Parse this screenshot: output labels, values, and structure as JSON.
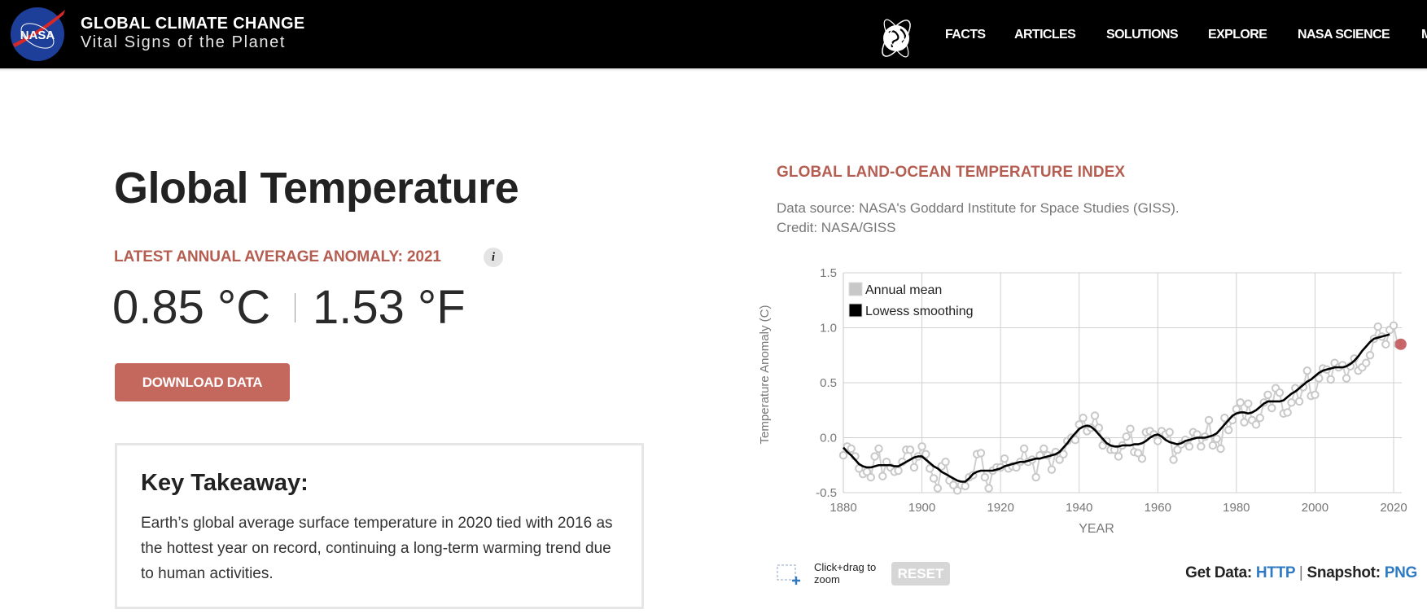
{
  "header": {
    "site_title": "GLOBAL CLIMATE CHANGE",
    "site_subtitle": "Vital Signs of the Planet",
    "logo_text": "NASA",
    "nav": [
      "FACTS",
      "ARTICLES",
      "SOLUTIONS",
      "EXPLORE",
      "NASA SCIENCE",
      "M"
    ]
  },
  "main": {
    "title": "Global Temperature",
    "anomaly_label": "LATEST ANNUAL AVERAGE ANOMALY: 2021",
    "info_icon": "i",
    "value_celsius": "0.85 °C",
    "value_fahrenheit": "1.53 °F",
    "download_label": "DOWNLOAD DATA",
    "takeaway_title": "Key Takeaway:",
    "takeaway_text": "Earth’s global average surface temperature in 2020 tied with 2016 as the hottest year on record, continuing a long-term warming trend due to human activities."
  },
  "chart_panel": {
    "title": "GLOBAL LAND-OCEAN TEMPERATURE INDEX",
    "source_line1": "Data source: NASA's Goddard Institute for Space Studies (GISS).",
    "source_line2": "Credit: NASA/GISS",
    "zoom_hint": "Click+drag to zoom",
    "reset_label": "RESET",
    "get_data_label": "Get Data:",
    "get_data_link": "HTTP",
    "separator": "|",
    "snapshot_label": "Snapshot:",
    "snapshot_link": "PNG"
  },
  "colors": {
    "accent": "#b55d51",
    "button": "#c4675d",
    "link": "#2e7bc4",
    "annual_mean": "#c8c8c8",
    "lowess": "#000000",
    "highlight": "#c4575a"
  },
  "chart_data": {
    "type": "line",
    "title": "GLOBAL LAND-OCEAN TEMPERATURE INDEX",
    "xlabel": "YEAR",
    "ylabel": "Temperature Anomaly (C)",
    "xlim": [
      1880,
      2021
    ],
    "ylim": [
      -0.5,
      1.5
    ],
    "xticks": [
      1880,
      1900,
      1920,
      1940,
      1960,
      1980,
      2000,
      2020
    ],
    "yticks": [
      "-0.5",
      "0.0",
      "0.5",
      "1.0",
      "1.5"
    ],
    "grid": true,
    "legend_position": "top-left",
    "legend": [
      "Annual mean",
      "Lowess smoothing"
    ],
    "x_start": 1880,
    "series": [
      {
        "name": "Annual mean",
        "values": [
          -0.16,
          -0.08,
          -0.1,
          -0.17,
          -0.28,
          -0.33,
          -0.31,
          -0.36,
          -0.17,
          -0.1,
          -0.35,
          -0.22,
          -0.27,
          -0.31,
          -0.3,
          -0.22,
          -0.11,
          -0.11,
          -0.27,
          -0.17,
          -0.08,
          -0.15,
          -0.28,
          -0.37,
          -0.46,
          -0.26,
          -0.22,
          -0.39,
          -0.43,
          -0.48,
          -0.43,
          -0.44,
          -0.36,
          -0.34,
          -0.15,
          -0.14,
          -0.36,
          -0.46,
          -0.3,
          -0.27,
          -0.27,
          -0.19,
          -0.28,
          -0.26,
          -0.27,
          -0.22,
          -0.1,
          -0.22,
          -0.2,
          -0.36,
          -0.16,
          -0.1,
          -0.16,
          -0.29,
          -0.13,
          -0.2,
          -0.15,
          -0.03,
          -0.0,
          -0.02,
          0.12,
          0.18,
          0.06,
          0.09,
          0.2,
          0.09,
          -0.07,
          -0.03,
          -0.11,
          -0.11,
          -0.17,
          -0.07,
          0.01,
          0.08,
          -0.13,
          -0.14,
          -0.19,
          0.05,
          0.06,
          0.03,
          -0.03,
          0.06,
          0.03,
          0.05,
          -0.2,
          -0.11,
          -0.06,
          -0.02,
          -0.08,
          0.05,
          0.03,
          -0.08,
          0.01,
          0.16,
          -0.07,
          -0.01,
          -0.1,
          0.18,
          0.07,
          0.16,
          0.26,
          0.32,
          0.14,
          0.31,
          0.16,
          0.12,
          0.18,
          0.32,
          0.39,
          0.27,
          0.45,
          0.41,
          0.22,
          0.23,
          0.32,
          0.45,
          0.33,
          0.46,
          0.61,
          0.38,
          0.39,
          0.54,
          0.63,
          0.62,
          0.53,
          0.68,
          0.64,
          0.66,
          0.54,
          0.65,
          0.72,
          0.61,
          0.64,
          0.68,
          0.75,
          0.9,
          1.01,
          0.92,
          0.85,
          0.98,
          1.02,
          0.85
        ]
      },
      {
        "name": "Lowess smoothing",
        "values": [
          -0.09,
          -0.13,
          -0.16,
          -0.2,
          -0.24,
          -0.26,
          -0.27,
          -0.27,
          -0.26,
          -0.25,
          -0.25,
          -0.25,
          -0.25,
          -0.26,
          -0.26,
          -0.24,
          -0.22,
          -0.2,
          -0.18,
          -0.17,
          -0.17,
          -0.2,
          -0.23,
          -0.26,
          -0.28,
          -0.31,
          -0.33,
          -0.35,
          -0.37,
          -0.39,
          -0.4,
          -0.4,
          -0.37,
          -0.33,
          -0.31,
          -0.3,
          -0.3,
          -0.3,
          -0.3,
          -0.29,
          -0.28,
          -0.26,
          -0.25,
          -0.24,
          -0.23,
          -0.22,
          -0.22,
          -0.21,
          -0.2,
          -0.19,
          -0.19,
          -0.18,
          -0.17,
          -0.16,
          -0.15,
          -0.13,
          -0.09,
          -0.05,
          0.0,
          0.04,
          0.08,
          0.1,
          0.11,
          0.1,
          0.07,
          0.03,
          -0.01,
          -0.05,
          -0.07,
          -0.08,
          -0.08,
          -0.07,
          -0.07,
          -0.07,
          -0.06,
          -0.06,
          -0.05,
          -0.03,
          0.0,
          0.02,
          0.03,
          0.01,
          -0.02,
          -0.04,
          -0.05,
          -0.06,
          -0.05,
          -0.03,
          -0.02,
          -0.01,
          0.0,
          0.0,
          0.0,
          0.01,
          0.02,
          0.04,
          0.08,
          0.12,
          0.16,
          0.2,
          0.22,
          0.23,
          0.23,
          0.22,
          0.23,
          0.25,
          0.28,
          0.31,
          0.33,
          0.33,
          0.33,
          0.33,
          0.34,
          0.37,
          0.4,
          0.42,
          0.45,
          0.48,
          0.51,
          0.53,
          0.56,
          0.59,
          0.61,
          0.62,
          0.63,
          0.64,
          0.64,
          0.64,
          0.65,
          0.67,
          0.7,
          0.74,
          0.79,
          0.83,
          0.87,
          0.9,
          0.91,
          0.92,
          0.93,
          0.94
        ]
      }
    ],
    "highlight_point": {
      "year": 2021,
      "value": 0.85
    }
  }
}
